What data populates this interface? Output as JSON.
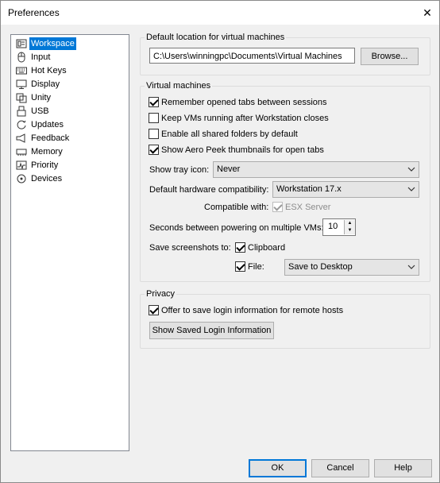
{
  "window": {
    "title": "Preferences",
    "close_glyph": "✕"
  },
  "sidebar": {
    "items": [
      {
        "label": "Workspace",
        "icon": "workspace-icon",
        "selected": true
      },
      {
        "label": "Input",
        "icon": "mouse-icon"
      },
      {
        "label": "Hot Keys",
        "icon": "keyboard-icon"
      },
      {
        "label": "Display",
        "icon": "monitor-icon"
      },
      {
        "label": "Unity",
        "icon": "unity-icon"
      },
      {
        "label": "USB",
        "icon": "usb-icon"
      },
      {
        "label": "Updates",
        "icon": "updates-icon"
      },
      {
        "label": "Feedback",
        "icon": "feedback-icon"
      },
      {
        "label": "Memory",
        "icon": "memory-icon"
      },
      {
        "label": "Priority",
        "icon": "priority-icon"
      },
      {
        "label": "Devices",
        "icon": "devices-icon"
      }
    ]
  },
  "location": {
    "group_title": "Default location for virtual machines",
    "path": "C:\\Users\\winningpc\\Documents\\Virtual Machines",
    "browse_label": "Browse..."
  },
  "vm": {
    "group_title": "Virtual machines",
    "checkboxes": [
      {
        "label": "Remember opened tabs between sessions",
        "checked": true
      },
      {
        "label": "Keep VMs running after Workstation closes",
        "checked": false
      },
      {
        "label": "Enable all shared folders by default",
        "checked": false
      },
      {
        "label": "Show Aero Peek thumbnails for open tabs",
        "checked": true
      }
    ],
    "tray_label": "Show tray icon:",
    "tray_value": "Never",
    "compat_label": "Default hardware compatibility:",
    "compat_value": "Workstation 17.x",
    "compatible_with_label": "Compatible with:",
    "esx_label": "ESX Server",
    "seconds_label": "Seconds between powering on multiple VMs:",
    "seconds_value": "10",
    "screenshots_label": "Save screenshots to:",
    "clipboard_label": "Clipboard",
    "file_label": "File:",
    "file_value": "Save to Desktop"
  },
  "privacy": {
    "group_title": "Privacy",
    "offer_label": "Offer to save login information for remote hosts",
    "show_saved_label": "Show Saved Login Information"
  },
  "buttons": {
    "ok": "OK",
    "cancel": "Cancel",
    "help": "Help"
  },
  "colors": {
    "accent": "#0078d7",
    "window_bg": "#f0f0f0"
  }
}
